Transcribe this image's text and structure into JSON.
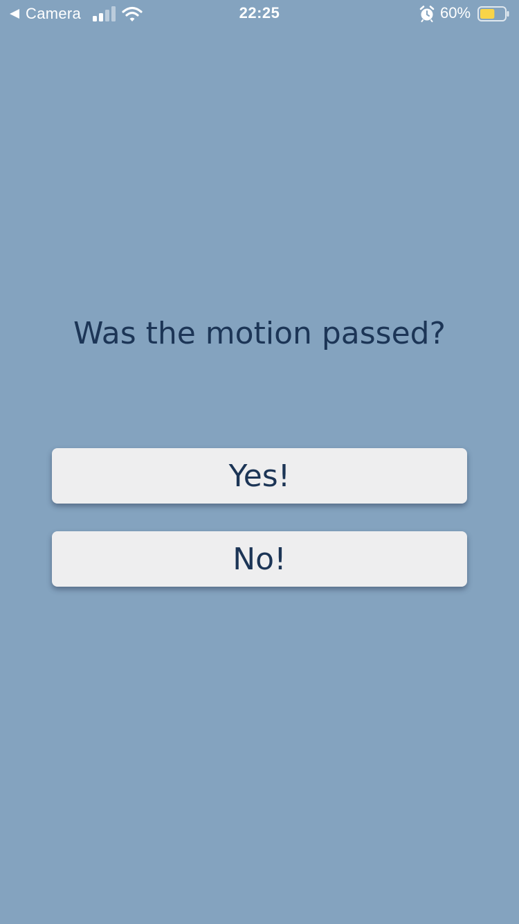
{
  "status_bar": {
    "back_app_label": "Camera",
    "time": "22:25",
    "battery_percent": "60%",
    "battery_level": 0.6,
    "battery_color": "#f8d448",
    "signal_icon": "cellular-signal-icon",
    "wifi_icon": "wifi-icon",
    "alarm_icon": "alarm-clock-icon"
  },
  "question": {
    "text": "Was the motion passed?"
  },
  "answers": {
    "yes_label": "Yes!",
    "no_label": "No!"
  },
  "colors": {
    "background": "#84a3bf",
    "text": "#1c3556",
    "button_bg": "#eeeeef"
  }
}
